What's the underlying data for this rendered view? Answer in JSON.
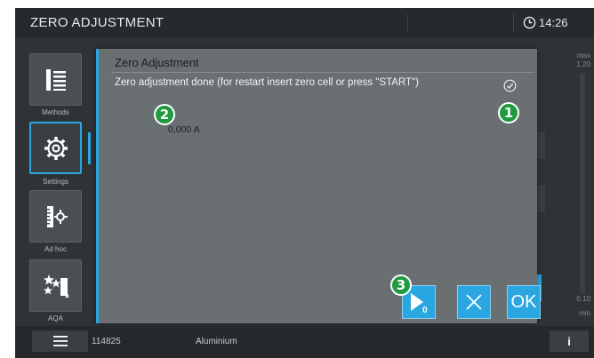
{
  "header": {
    "title": "ZERO ADJUSTMENT",
    "time": "14:26",
    "clock_icon": "clock-icon"
  },
  "sidebar": {
    "items": [
      {
        "label": "Methods",
        "icon": "methods-icon"
      },
      {
        "label": "Settings",
        "icon": "gear-icon",
        "active": true
      },
      {
        "label": "Ad hoc",
        "icon": "ad-hoc-icon"
      },
      {
        "label": "AQA",
        "icon": "aqa-icon"
      }
    ]
  },
  "scale": {
    "max_label": "max",
    "top_value": "1.20",
    "bottom_value": "0.10",
    "min_label": "min"
  },
  "dialog": {
    "title": "Zero Adjustment",
    "message": "Zero adjustment done (for restart insert zero cell or press \"START\")",
    "status_icon": "check-circle-icon",
    "reading": "0,000 A",
    "buttons": {
      "start_icon": "start-zero-icon",
      "cancel_icon": "close-icon",
      "ok_label": "OK"
    }
  },
  "callouts": {
    "c1": "1",
    "c2": "2",
    "c3": "3"
  },
  "footer": {
    "menu_icon": "menu-icon",
    "id": "114825",
    "material": "Aluminium",
    "info_label": "i"
  },
  "colors": {
    "accent": "#2aa7e1",
    "callout": "#1f9a3f",
    "dialog_bg": "#6a6f72",
    "app_bg": "#2f3336"
  }
}
